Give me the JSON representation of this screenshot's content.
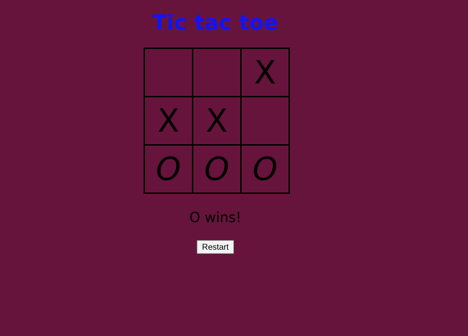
{
  "game": {
    "title": "Tic tac toe",
    "board": [
      [
        "",
        "",
        "X"
      ],
      [
        "X",
        "X",
        ""
      ],
      [
        "O",
        "O",
        "O"
      ]
    ],
    "status": "O wins!",
    "restart_label": "Restart"
  },
  "colors": {
    "background": "#66143c",
    "title": "#0f14ff",
    "grid_lines": "#000000",
    "marks": "#000000"
  }
}
